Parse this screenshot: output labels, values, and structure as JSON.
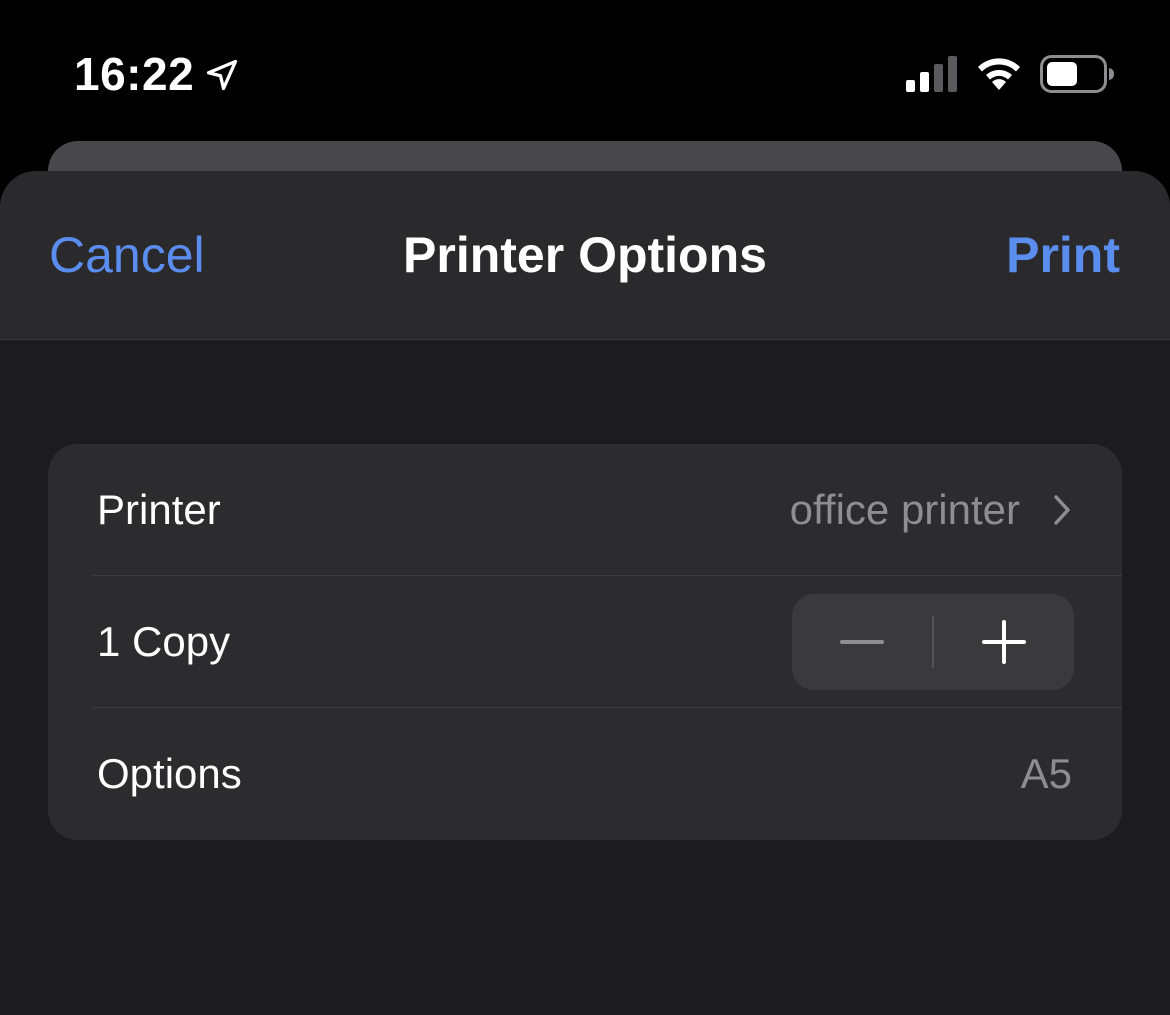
{
  "status_bar": {
    "time": "16:22",
    "icons": [
      "location-arrow-icon",
      "cellular-signal-icon",
      "wifi-icon",
      "battery-icon"
    ]
  },
  "nav": {
    "cancel_label": "Cancel",
    "title": "Printer Options",
    "print_label": "Print"
  },
  "settings": {
    "printer": {
      "label": "Printer",
      "value": "office printer",
      "icon": "chevron-right-icon"
    },
    "copies": {
      "label": "1 Copy",
      "decrement_icon": "minus-icon",
      "increment_icon": "plus-icon"
    },
    "options": {
      "label": "Options",
      "value": "A5"
    }
  },
  "colors": {
    "accent": "#5b8def",
    "background": "#000000",
    "sheet": "#1c1c1e",
    "nav_bar": "#2a2a2c",
    "group": "#2c2c2e",
    "secondary_text": "#8d8d92"
  }
}
